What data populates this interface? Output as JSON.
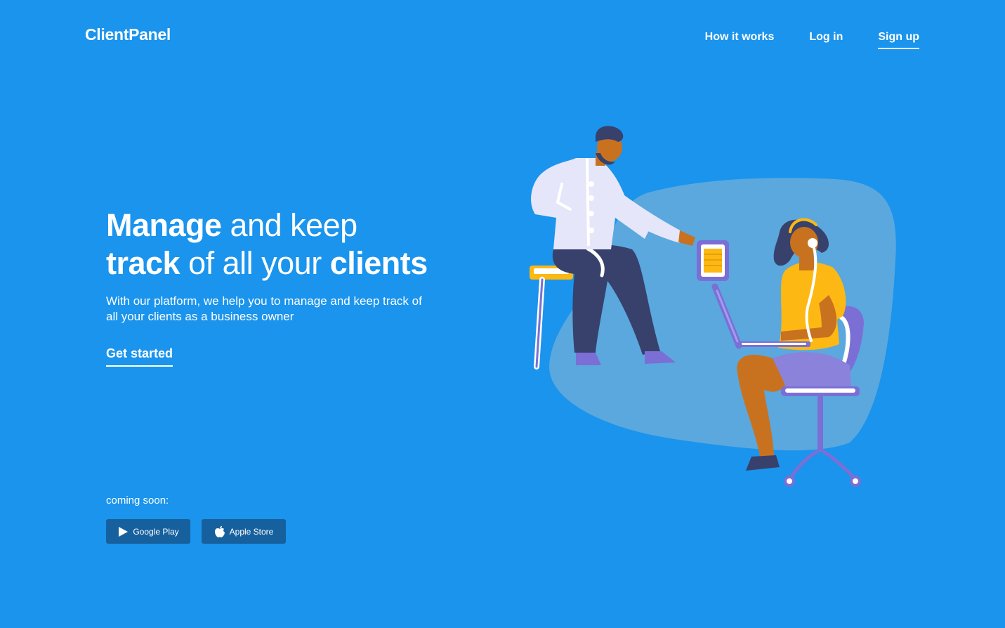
{
  "brand": {
    "name": "ClientPanel"
  },
  "nav": {
    "items": [
      {
        "label": "How it works"
      },
      {
        "label": "Log in"
      },
      {
        "label": "Sign up"
      }
    ]
  },
  "hero": {
    "title_line1_bold": "Manage",
    "title_line1_rest": " and keep",
    "title_line2_bold1": "track",
    "title_line2_mid": " of all your ",
    "title_line2_bold2": "clients",
    "subtitle": "With our platform, we help you to manage and keep track of all your clients as a business owner",
    "cta_label": "Get started"
  },
  "coming_soon": {
    "label": "coming soon:",
    "stores": [
      {
        "label": "Google Play",
        "icon": "play-icon"
      },
      {
        "label": "Apple Store",
        "icon": "apple-icon"
      }
    ]
  },
  "colors": {
    "background": "#1a94ed",
    "store_button": "#17609e",
    "blob": "#5aa8de",
    "accent_yellow": "#fdb813",
    "accent_purple": "#7b6fd6"
  }
}
